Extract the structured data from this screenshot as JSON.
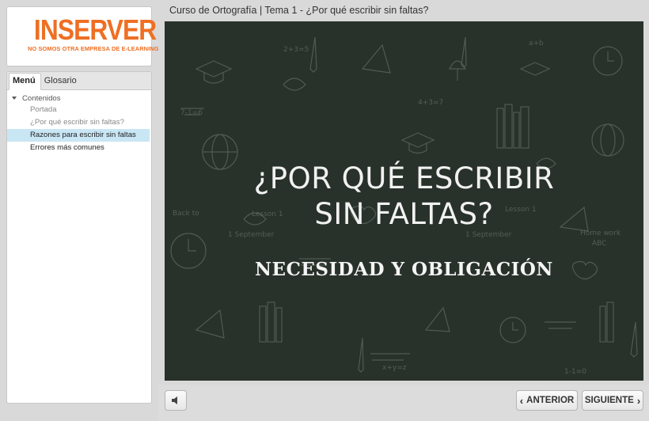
{
  "logo": {
    "brand": "INSERVER",
    "tagline": "NO SOMOS OTRA EMPRESA DE E-LEARNING",
    "color": "#ee6f24"
  },
  "sidebar": {
    "tabs": [
      {
        "label": "Menú",
        "active": true
      },
      {
        "label": "Glosario",
        "active": false
      }
    ],
    "tree": {
      "section_label": "Contenidos",
      "items": [
        {
          "label": "Portada",
          "state": "visited"
        },
        {
          "label": "¿Por qué escribir sin faltas?",
          "state": "visited"
        },
        {
          "label": "Razones para escribir sin faltas",
          "state": "current"
        },
        {
          "label": "Errores más comunes",
          "state": "unvisited"
        }
      ]
    }
  },
  "header": {
    "title": "Curso de Ortografía | Tema 1 - ¿Por qué escribir sin faltas?"
  },
  "slide": {
    "title_line1": "¿POR QUÉ ESCRIBIR",
    "title_line2": "SIN FALTAS?",
    "subtitle": "NECESIDAD Y OBLIGACIÓN",
    "background_color": "#28312a"
  },
  "controls": {
    "volume_icon": "speaker-icon",
    "prev_label": "ANTERIOR",
    "next_label": "SIGUIENTE"
  }
}
